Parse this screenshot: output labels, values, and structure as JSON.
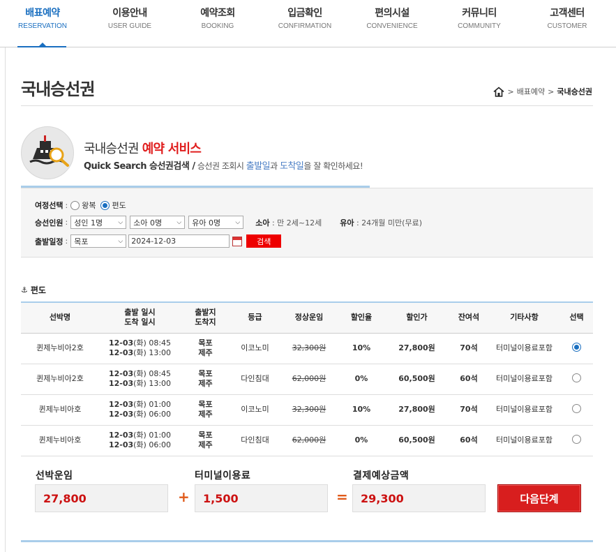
{
  "nav": [
    {
      "ko": "배표예약",
      "en": "RESERVATION",
      "active": true
    },
    {
      "ko": "이용안내",
      "en": "USER GUIDE"
    },
    {
      "ko": "예약조회",
      "en": "BOOKING"
    },
    {
      "ko": "입금확인",
      "en": "CONFIRMATION"
    },
    {
      "ko": "편의시설",
      "en": "CONVENIENCE"
    },
    {
      "ko": "커뮤니티",
      "en": "COMMUNITY"
    },
    {
      "ko": "고객센터",
      "en": "CUSTOMER"
    }
  ],
  "page_title": "국내승선권",
  "breadcrumb": {
    "sep1": ">",
    "item1": "배표예약",
    "sep2": ">",
    "current": "국내승선권"
  },
  "service": {
    "title_prefix": "국내승선권 ",
    "title_highlight": "예약 서비스",
    "sub_bold": "Quick Search 승선권검색 /",
    "sub_text1": " 승선권 조회시 ",
    "sub_blue1": "출발일",
    "sub_text2": "과 ",
    "sub_blue2": "도착일",
    "sub_text3": "을 잘 확인하세요!"
  },
  "search": {
    "trip_label": "여정선택",
    "round_label": "왕복",
    "oneway_label": "편도",
    "passenger_label": "승선인원",
    "adult": "성인 1명",
    "child": "소아 0명",
    "infant": "유아 0명",
    "child_hint_label": "소아",
    "child_hint": ": 만 2세~12세",
    "infant_hint_label": "유아",
    "infant_hint": ": 24개월 미만(무료)",
    "date_label": "출발일정",
    "port": "목포",
    "date": "2024-12-03",
    "search_btn": "검색"
  },
  "section_title": "편도",
  "table": {
    "headers": {
      "ship": "선박명",
      "dep_time": "출발 일시",
      "arr_time": "도착 일시",
      "dep_port": "출발지",
      "arr_port": "도착지",
      "grade": "등급",
      "normal": "정상운임",
      "discount_rate": "할인율",
      "discount_price": "할인가",
      "seats": "잔여석",
      "etc": "기타사항",
      "select": "선택"
    },
    "rows": [
      {
        "ship": "퀸제누비아2호",
        "dep_date": "12-03",
        "dep_day": "(화)",
        "dep_time": " 08:45",
        "arr_date": "12-03",
        "arr_day": "(화)",
        "arr_time": " 13:00",
        "from": "목포",
        "to": "제주",
        "grade": "이코노미",
        "normal": "32,300원",
        "rate": "10%",
        "price": "27,800원",
        "seats": "70석",
        "etc": "터미널이용료포함",
        "selected": true
      },
      {
        "ship": "퀸제누비아2호",
        "dep_date": "12-03",
        "dep_day": "(화)",
        "dep_time": " 08:45",
        "arr_date": "12-03",
        "arr_day": "(화)",
        "arr_time": " 13:00",
        "from": "목포",
        "to": "제주",
        "grade": "다인침대",
        "normal": "62,000원",
        "rate": "0%",
        "price": "60,500원",
        "seats": "60석",
        "etc": "터미널이용료포함",
        "selected": false
      },
      {
        "ship": "퀸제누비아호",
        "dep_date": "12-03",
        "dep_day": "(화)",
        "dep_time": " 01:00",
        "arr_date": "12-03",
        "arr_day": "(화)",
        "arr_time": " 06:00",
        "from": "목포",
        "to": "제주",
        "grade": "이코노미",
        "normal": "32,300원",
        "rate": "10%",
        "price": "27,800원",
        "seats": "70석",
        "etc": "터미널이용료포함",
        "selected": false
      },
      {
        "ship": "퀸제누비아호",
        "dep_date": "12-03",
        "dep_day": "(화)",
        "dep_time": " 01:00",
        "arr_date": "12-03",
        "arr_day": "(화)",
        "arr_time": " 06:00",
        "from": "목포",
        "to": "제주",
        "grade": "다인침대",
        "normal": "62,000원",
        "rate": "0%",
        "price": "60,500원",
        "seats": "60석",
        "etc": "터미널이용료포함",
        "selected": false
      }
    ]
  },
  "summary": {
    "fare_label": "선박운임",
    "fare": "27,800",
    "plus": "+",
    "terminal_label": "터미널이용료",
    "terminal": "1,500",
    "equals": "=",
    "total_label": "결제예상금액",
    "total": "29,300",
    "next_btn": "다음단계"
  },
  "colors": {
    "accent_blue": "#1a6fc0",
    "accent_red": "#e01e1e",
    "discount_green": "#2a9d22",
    "line_blue": "#a9cdea"
  }
}
